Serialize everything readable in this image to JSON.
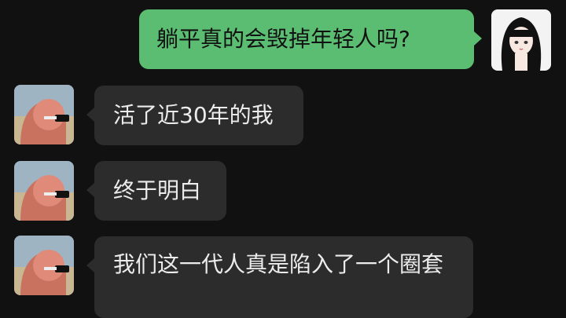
{
  "messages": [
    {
      "side": "outgoing",
      "text": "躺平真的会毁掉年轻人吗?"
    },
    {
      "side": "incoming",
      "text": "活了近30年的我"
    },
    {
      "side": "incoming",
      "text": "终于明白"
    },
    {
      "side": "incoming",
      "text": "我们这一代人真是陷入了一个圈套"
    }
  ],
  "avatars": {
    "self": "anime-girl-avatar",
    "other": "pink-masked-figure-avatar"
  },
  "colors": {
    "background": "#111111",
    "incoming_bubble": "#2c2c2c",
    "outgoing_bubble": "#5bbd72"
  }
}
